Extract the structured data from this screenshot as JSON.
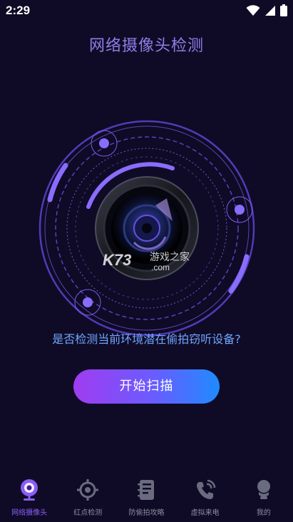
{
  "status_bar": {
    "time": "2:29"
  },
  "page": {
    "title": "网络摄像头检测",
    "question": "是否检测当前环境潜在偷拍窃听设备?"
  },
  "actions": {
    "scan_label": "开始扫描"
  },
  "watermark": {
    "brand": "K73",
    "site": "游戏之家",
    "domain": ".com"
  },
  "tabs": [
    {
      "label": "网络摄像头",
      "icon": "webcam-icon",
      "active": true
    },
    {
      "label": "红点检测",
      "icon": "crosshair-icon",
      "active": false
    },
    {
      "label": "防偷拍攻略",
      "icon": "notebook-icon",
      "active": false
    },
    {
      "label": "虚拟来电",
      "icon": "phone-icon",
      "active": false
    },
    {
      "label": "我的",
      "icon": "profile-icon",
      "active": false
    }
  ],
  "colors": {
    "background": "#0f0b26",
    "accent": "#8a5cf6",
    "question": "#6fa6ff"
  }
}
